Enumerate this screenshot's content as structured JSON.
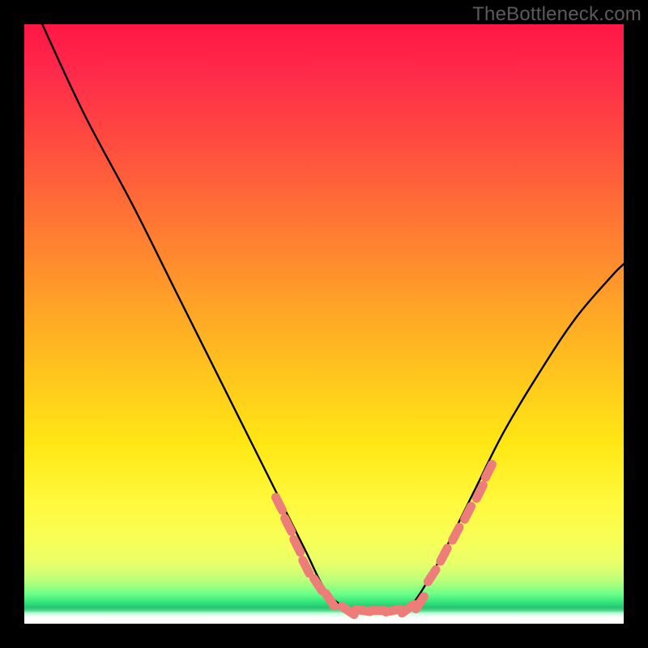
{
  "watermark": "TheBottleneck.com",
  "chart_data": {
    "type": "line",
    "title": "",
    "xlabel": "",
    "ylabel": "",
    "xlim": [
      0,
      100
    ],
    "ylim": [
      0,
      100
    ],
    "grid": false,
    "legend": false,
    "series": [
      {
        "name": "curve",
        "x": [
          3,
          10,
          18,
          25,
          32,
          38,
          43,
          47,
          50,
          53,
          56,
          60,
          62,
          64,
          66,
          70,
          75,
          80,
          86,
          92,
          98,
          100
        ],
        "y": [
          100,
          85,
          70,
          56,
          42,
          30,
          20,
          12,
          6,
          3,
          2,
          2,
          2,
          2.8,
          5,
          12,
          22,
          32,
          42,
          51,
          58,
          60
        ]
      }
    ],
    "markers": {
      "left_cluster": {
        "x": [
          42.5,
          44,
          45.5,
          47,
          49,
          51
        ],
        "y": [
          20,
          16.5,
          13,
          9.5,
          6.5,
          4
        ]
      },
      "bottom_cluster": {
        "x": [
          54,
          56.5,
          59,
          61.5,
          64,
          66
        ],
        "y": [
          2.2,
          2.2,
          2.2,
          2.2,
          2.5,
          3.5
        ]
      },
      "right_cluster": {
        "x": [
          68,
          70,
          72,
          74,
          76,
          77.5
        ],
        "y": [
          8,
          11.5,
          15,
          18.5,
          22,
          25.5
        ]
      }
    },
    "tick_cluster_color": "#ed7d79",
    "line_color": "#000000"
  }
}
